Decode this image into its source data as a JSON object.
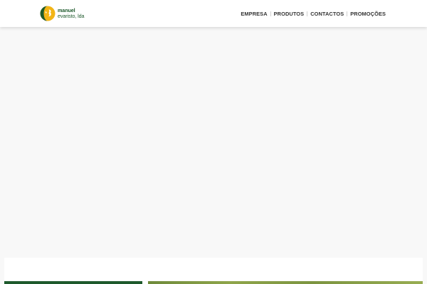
{
  "brand": {
    "line1": "manuel",
    "line2": "evaristo, lda",
    "colors": {
      "green": "#1e5a2c",
      "yellow": "#f2b516"
    },
    "icon": "brand-logo-mark"
  },
  "nav": {
    "items": [
      {
        "label": "EMPRESA"
      },
      {
        "label": "PRODUTOS"
      },
      {
        "label": "CONTACTOS"
      },
      {
        "label": "PROMOÇÕES"
      }
    ]
  },
  "theme": {
    "accent": "#1e5a2c",
    "nav_text": "#333333",
    "page_bg": "#f8f8f8"
  }
}
